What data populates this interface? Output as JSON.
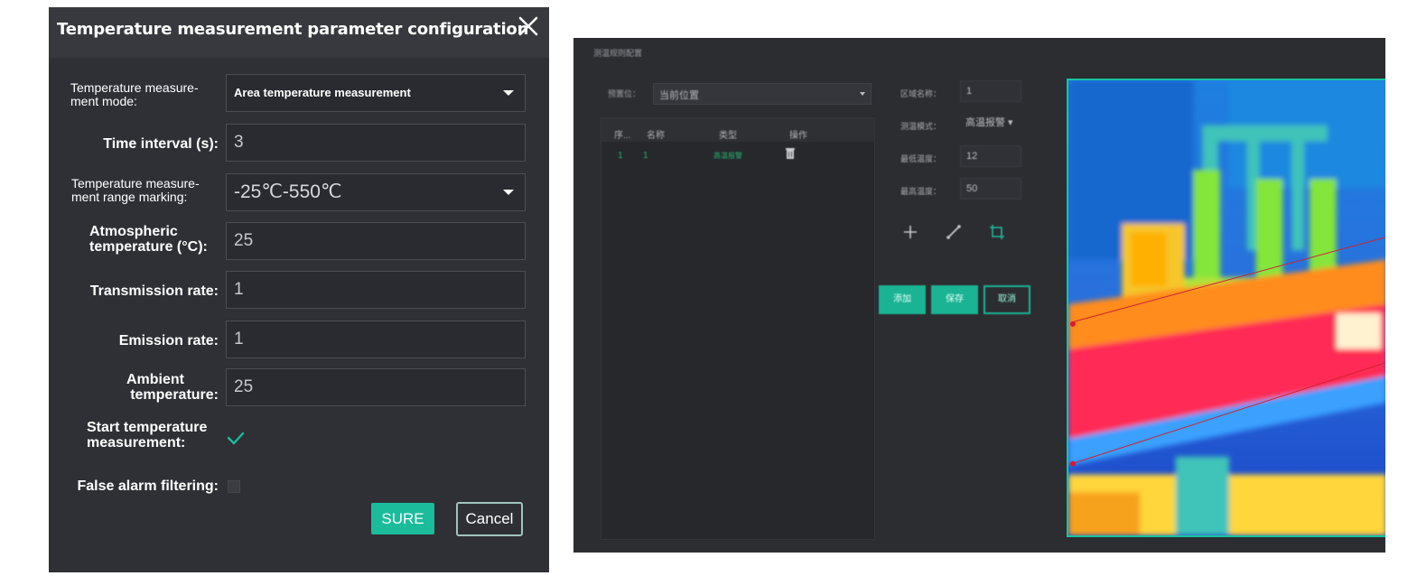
{
  "dialog": {
    "title": "Temperature measurement parameter configuration",
    "fields": [
      {
        "label": "Temperature measure-ment mode:",
        "label_lines": [
          "Temperature measure-",
          "ment mode:"
        ],
        "value": "Area temperature measurement",
        "kind": "select"
      },
      {
        "label": "Time interval (s):",
        "value": "3",
        "kind": "text"
      },
      {
        "label": "Temperature measure-ment range marking:",
        "label_lines": [
          "Temperature measure-",
          "ment range marking:"
        ],
        "value": "-25℃-550℃",
        "kind": "select"
      },
      {
        "label": "Atmospheric temperature (°C):",
        "label_lines": [
          "Atmospheric",
          "temperature (°C):"
        ],
        "value": "25",
        "kind": "text"
      },
      {
        "label": "Transmission rate:",
        "value": "1",
        "kind": "text"
      },
      {
        "label": "Emission rate:",
        "value": "1",
        "kind": "text"
      },
      {
        "label": "Ambient temperature:",
        "label_lines": [
          "Ambient",
          "temperature:"
        ],
        "value": "25",
        "kind": "text"
      }
    ],
    "start_measurement": {
      "label_lines": [
        "Start temperature",
        "measurement:"
      ],
      "checked": true
    },
    "false_alarm": {
      "label": "False alarm filtering:",
      "checked": false
    },
    "sure_label": "SURE",
    "cancel_label": "Cancel",
    "colors": {
      "bg": "#2f3035",
      "header": "#38393e",
      "accent": "#1abc9c"
    }
  },
  "secondary_screenshot": {
    "title": "测温规则配置",
    "preset_label": "预置位：",
    "preset_value": "当前位置",
    "list_headers": [
      "序...",
      "名称",
      "类型",
      "操作"
    ],
    "list_rows": [
      {
        "index": "1",
        "name": "1",
        "type": "高温报警"
      }
    ],
    "settings": [
      {
        "label": "区域名称：",
        "value": "1"
      },
      {
        "label": "测温模式：",
        "value": "高温报警 ▾"
      },
      {
        "label": "最低温度：",
        "value": "12"
      },
      {
        "label": "最高温度：",
        "value": "50"
      }
    ],
    "tool_icons": [
      "plus-icon",
      "line-icon",
      "crop-area-icon"
    ],
    "buttons": [
      "添加",
      "保存",
      "取消"
    ],
    "accent_color": "#17c4a2"
  }
}
